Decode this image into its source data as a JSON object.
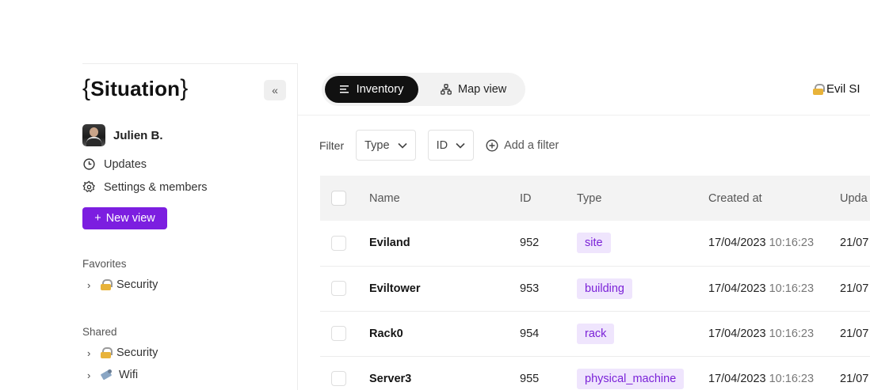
{
  "sidebar": {
    "logo": "Situation",
    "collapse_label": "«",
    "user_name": "Julien B.",
    "nav": {
      "updates": "Updates",
      "settings": "Settings & members"
    },
    "new_view_label": "New view",
    "favorites": {
      "title": "Favorites",
      "items": [
        {
          "label": "Security",
          "icon": "lock-icon"
        }
      ]
    },
    "shared": {
      "title": "Shared",
      "items": [
        {
          "label": "Security",
          "icon": "lock-icon"
        },
        {
          "label": "Wifi",
          "icon": "satellite-icon"
        }
      ]
    }
  },
  "topbar": {
    "tabs": [
      {
        "label": "Inventory",
        "active": true
      },
      {
        "label": "Map view",
        "active": false
      }
    ],
    "workspace": "Evil SI"
  },
  "filters": {
    "label": "Filter",
    "selects": [
      {
        "value": "Type"
      },
      {
        "value": "ID"
      }
    ],
    "add_label": "Add a filter"
  },
  "table": {
    "columns": [
      "Name",
      "ID",
      "Type",
      "Created at",
      "Upda"
    ],
    "rows": [
      {
        "name": "Eviland",
        "id": "952",
        "type": "site",
        "created_date": "17/04/2023",
        "created_time": "10:16:23",
        "updated": "21/07"
      },
      {
        "name": "Eviltower",
        "id": "953",
        "type": "building",
        "created_date": "17/04/2023",
        "created_time": "10:16:23",
        "updated": "21/07"
      },
      {
        "name": "Rack0",
        "id": "954",
        "type": "rack",
        "created_date": "17/04/2023",
        "created_time": "10:16:23",
        "updated": "21/07"
      },
      {
        "name": "Server3",
        "id": "955",
        "type": "physical_machine",
        "created_date": "17/04/2023",
        "created_time": "10:16:23",
        "updated": "21/07"
      }
    ]
  },
  "colors": {
    "accent": "#7c1ee0",
    "tag_bg": "#efe5fd",
    "tag_text": "#7b22d8"
  }
}
